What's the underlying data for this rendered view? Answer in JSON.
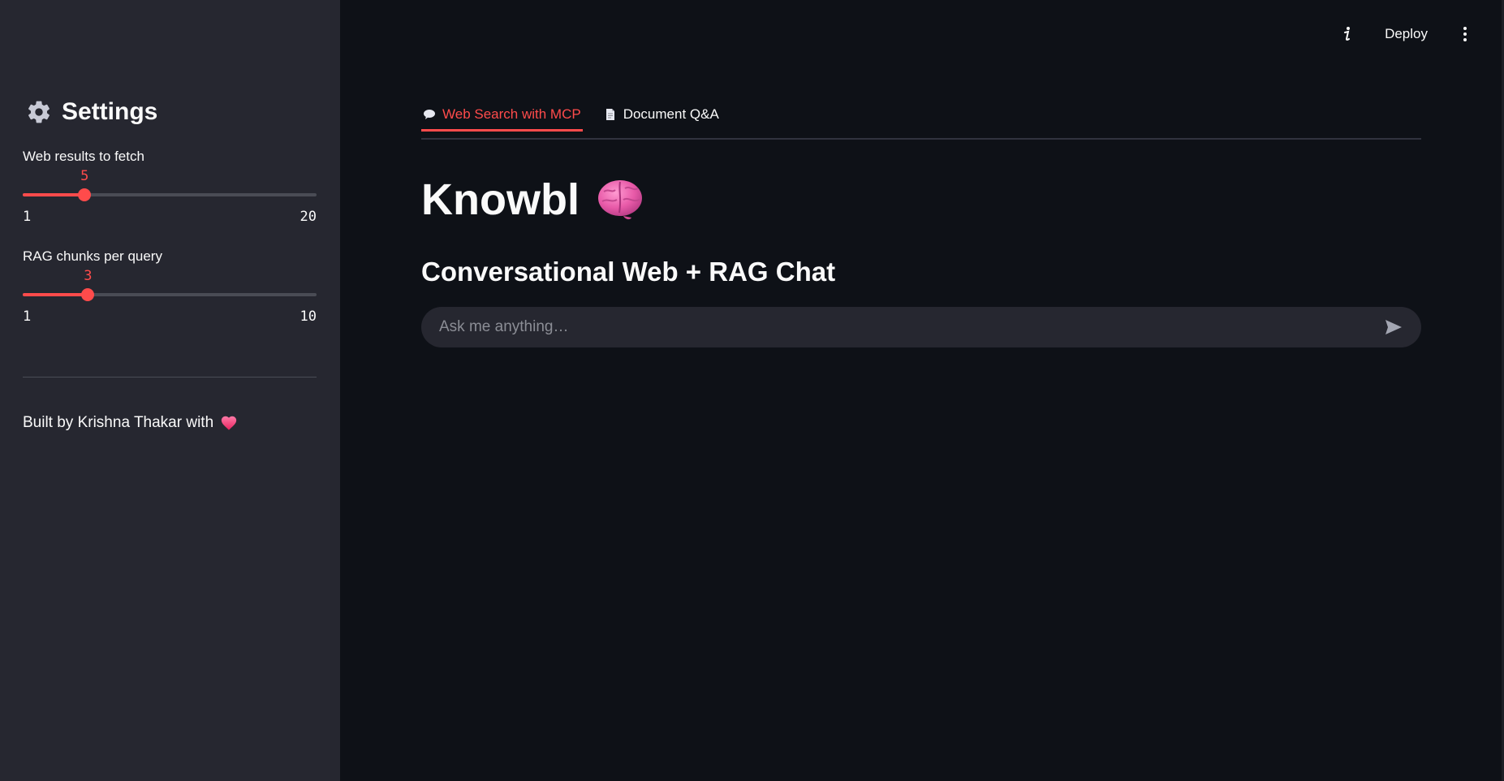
{
  "sidebar": {
    "title": "Settings",
    "sliders": [
      {
        "label": "Web results to fetch",
        "value": "5",
        "min": "1",
        "max": "20",
        "fraction": 0.2105
      },
      {
        "label": "RAG chunks per query",
        "value": "3",
        "min": "1",
        "max": "10",
        "fraction": 0.2222
      }
    ],
    "footer": "Built by Krishna Thakar with"
  },
  "topbar": {
    "deploy_label": "Deploy"
  },
  "tabs": [
    {
      "label": "Web Search with MCP",
      "active": true
    },
    {
      "label": "Document Q&A",
      "active": false
    }
  ],
  "main": {
    "title": "Knowbl",
    "subtitle": "Conversational Web + RAG Chat"
  },
  "chat": {
    "placeholder": "Ask me anything…"
  },
  "colors": {
    "accent": "#ff4b4b",
    "sidebar_bg": "#262730",
    "main_bg": "#0e1117",
    "text": "#fafafa"
  },
  "icons": {
    "settings": "gear-icon",
    "heart": "heart-icon",
    "brain": "brain-icon",
    "tab1": "speech-bubble-icon",
    "tab2": "document-icon",
    "send": "send-icon",
    "info": "info-icon",
    "menu": "kebab-menu-icon"
  }
}
